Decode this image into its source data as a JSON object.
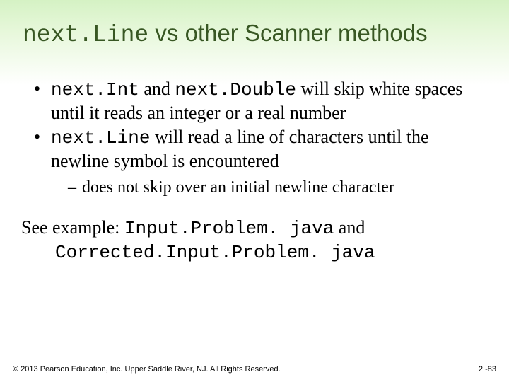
{
  "title": {
    "code": "next.Line",
    "rest": " vs other Scanner methods"
  },
  "bullets": [
    {
      "parts": [
        {
          "code": true,
          "text": "next.Int"
        },
        {
          "code": false,
          "text": " and "
        },
        {
          "code": true,
          "text": "next.Double"
        },
        {
          "code": false,
          "text": " will skip white spaces until it reads an integer or a real number"
        }
      ]
    },
    {
      "parts": [
        {
          "code": true,
          "text": "next.Line"
        },
        {
          "code": false,
          "text": " will read a line of characters until the newline symbol is encountered"
        }
      ],
      "sub": [
        "does not skip over an initial newline character"
      ]
    }
  ],
  "see": {
    "prefix": "See example: ",
    "file1": "Input.Problem. java",
    "mid": " and",
    "file2": "Corrected.Input.Problem. java"
  },
  "footer": {
    "copyright": "© 2013 Pearson Education, Inc. Upper Saddle River, NJ. All Rights Reserved.",
    "page": "2 -83"
  }
}
